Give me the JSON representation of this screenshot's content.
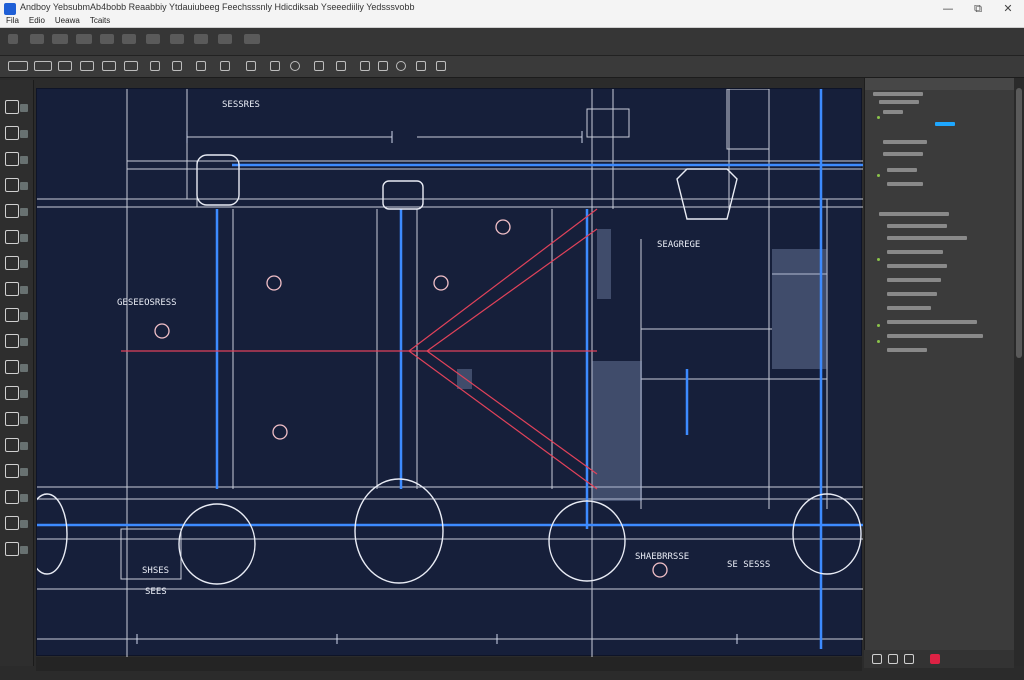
{
  "window": {
    "title": "Andboy YebsubmAb4bobb Reaabbiy Ytdauiubeeg Feechsssnly Hdicdiksab Yseeediiliy Yedsssvobb",
    "menus": [
      "Fila",
      "Edio",
      "Ueawa",
      "Tcaits"
    ],
    "controls": {
      "minimize": "—",
      "maximize": "⧉",
      "close": "✕"
    }
  },
  "colors": {
    "canvas_background": "#161f3a",
    "line_white": "#e9ecf5",
    "line_blue": "#3d8bff",
    "line_red": "#e0425a",
    "panel_background": "#3b3b3b",
    "accent_green": "#8bc34a",
    "selection_blue": "#1ea7ff"
  },
  "drawing": {
    "labels": [
      "SESSRES",
      "GESEEOSRESS",
      "SEAGREGE",
      "SHAEBRRSSE",
      "SE SESSS",
      "SHSES",
      "SEES"
    ]
  }
}
